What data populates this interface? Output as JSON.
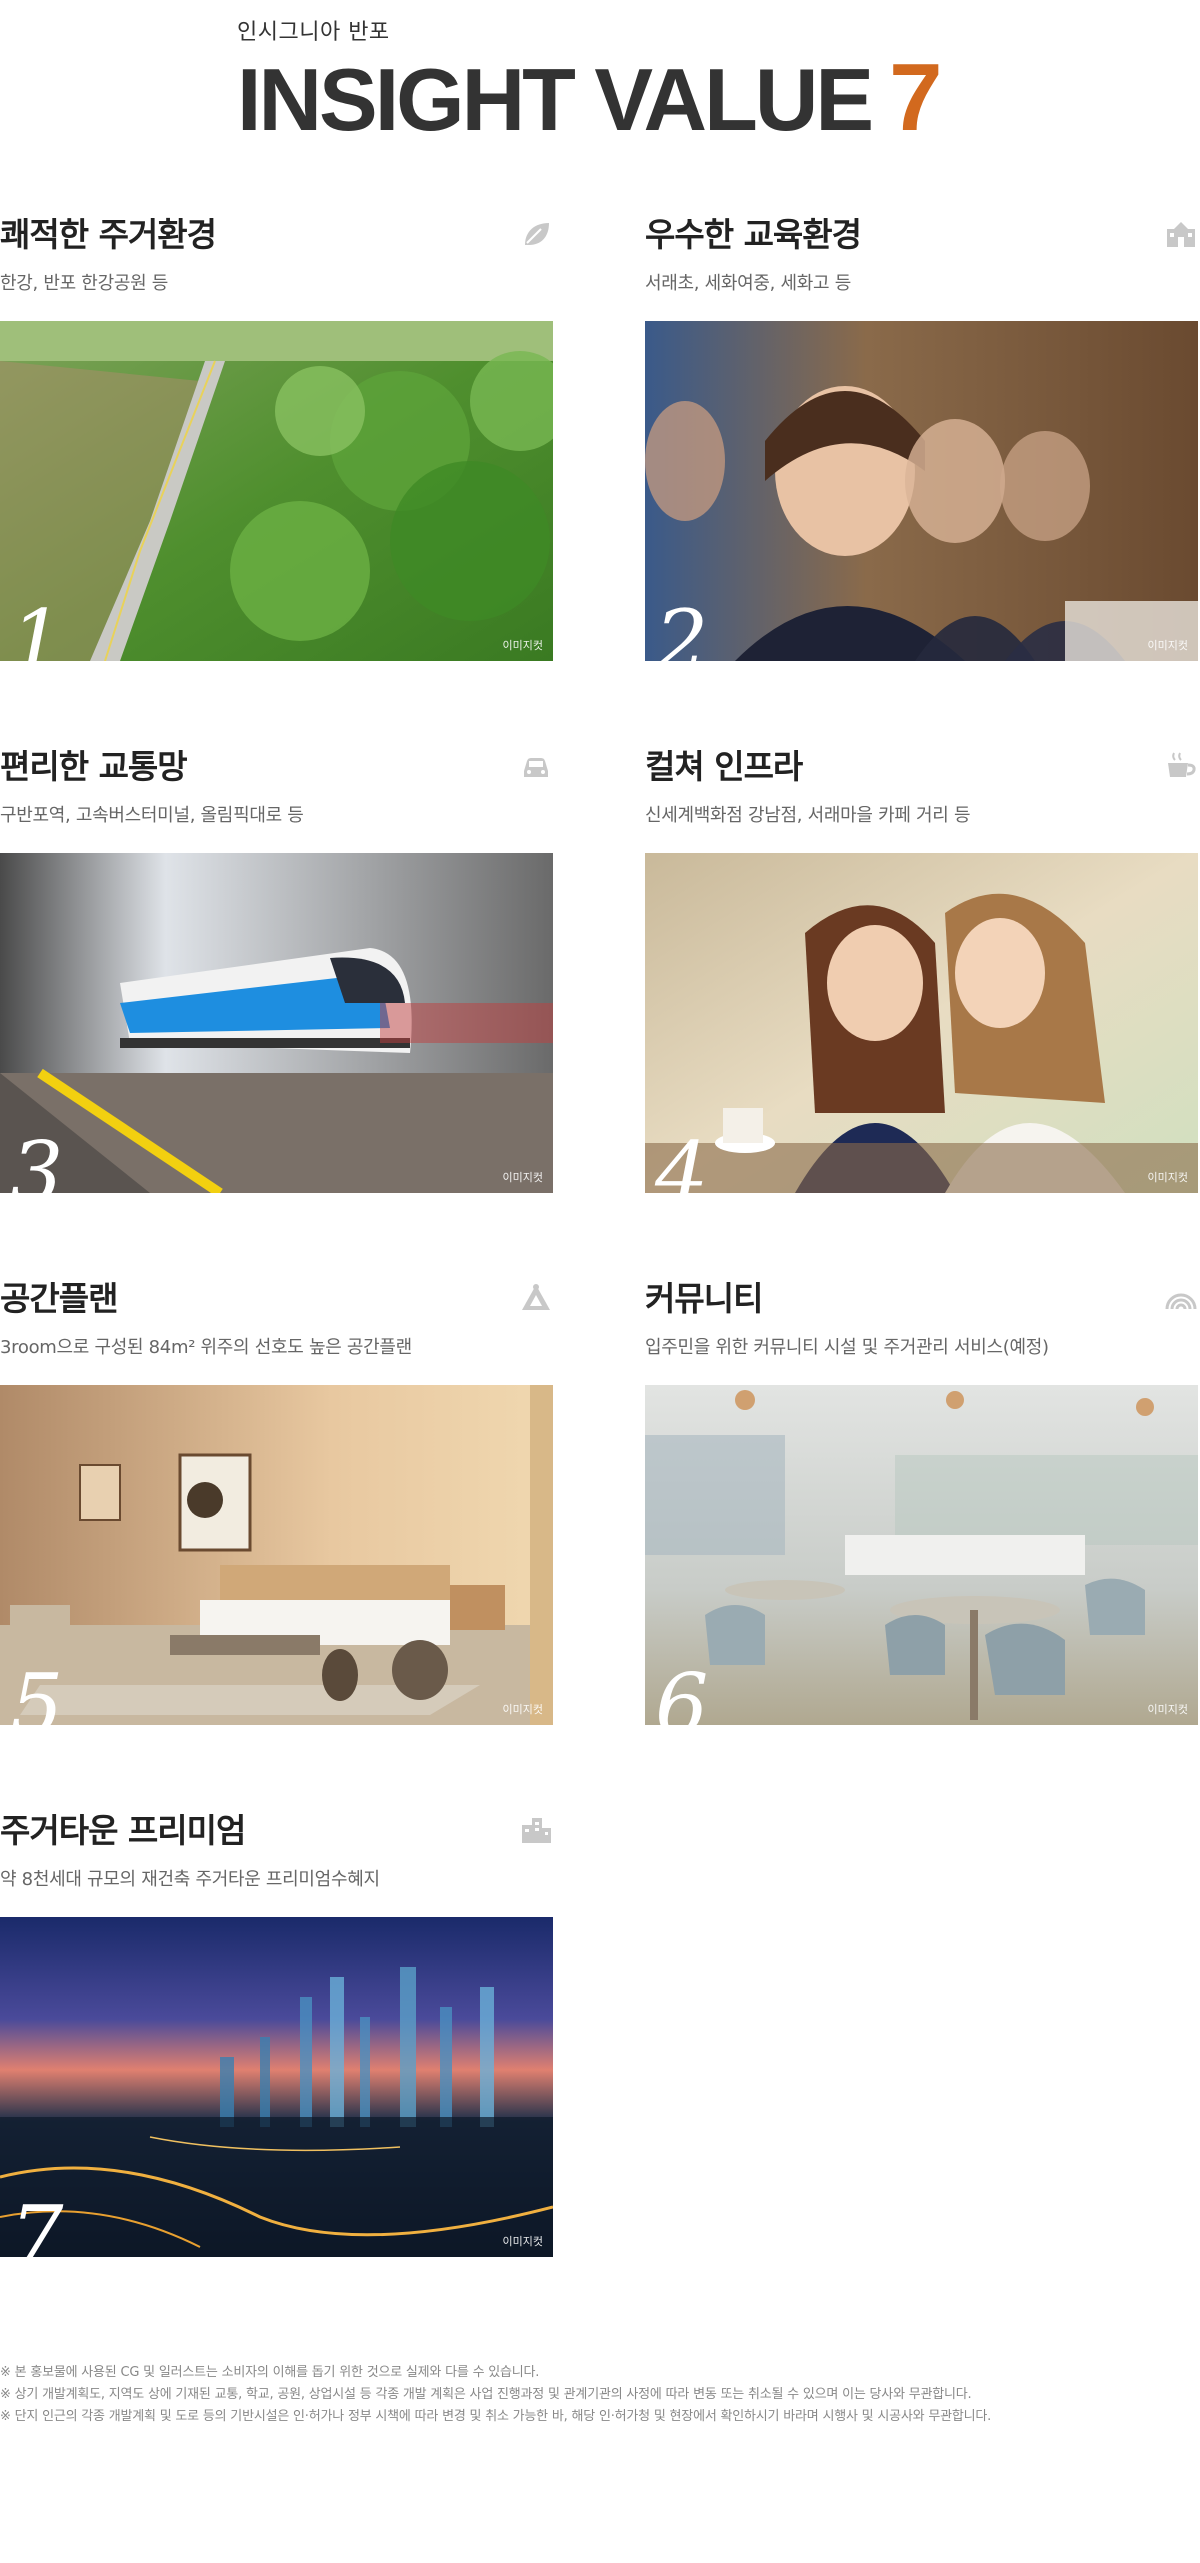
{
  "header": {
    "subtitle": "인시그니아 반포",
    "headline": "INSIGHT VALUE",
    "headline_number": "7",
    "accent_color": "#d2691e"
  },
  "cards": [
    {
      "title": "쾌적한 주거환경",
      "desc": "한강, 반포 한강공원 등",
      "number": "1",
      "tag": "이미지컷",
      "icon": "leaf-icon"
    },
    {
      "title": "우수한 교육환경",
      "desc": "서래초, 세화여중, 세화고 등",
      "number": "2",
      "tag": "이미지컷",
      "icon": "school-icon"
    },
    {
      "title": "편리한 교통망",
      "desc": "구반포역, 고속버스터미널, 올림픽대로 등",
      "number": "3",
      "tag": "이미지컷",
      "icon": "car-icon"
    },
    {
      "title": "컬쳐 인프라",
      "desc": "신세계백화점 강남점, 서래마을 카페 거리 등",
      "number": "4",
      "tag": "이미지컷",
      "icon": "coffee-cup-icon"
    },
    {
      "title": "공간플랜",
      "desc": "3room으로 구성된 84m² 위주의 선호도 높은 공간플랜",
      "number": "5",
      "tag": "이미지컷",
      "icon": "triangle-ruler-icon"
    },
    {
      "title": "커뮤니티",
      "desc": "입주민을 위한 커뮤니티 시설 및 주거관리 서비스(예정)",
      "number": "6",
      "tag": "이미지컷",
      "icon": "rainbow-icon"
    },
    {
      "title": "주거타운 프리미엄",
      "desc": "약 8천세대 규모의 재건축 주거타운 프리미엄수혜지",
      "number": "7",
      "tag": "이미지컷",
      "icon": "buildings-icon"
    }
  ],
  "notes": [
    "※ 본 홍보물에 사용된 CG 및 일러스트는 소비자의 이해를 돕기 위한 것으로 실제와 다를 수 있습니다.",
    "※ 상기 개발계획도, 지역도 상에 기재된 교통, 학교, 공원, 상업시설 등 각종 개발 계획은 사업 진행과정 및 관계기관의 사정에 따라 변동 또는 취소될 수 있으며 이는 당사와 무관합니다.",
    "※ 단지 인근의 각종 개발계획 및 도로 등의 기반시설은 인·허가나 정부 시책에 따라 변경 및 취소 가능한 바, 해당 인·허가청 및 현장에서 확인하시기 바라며 시행사 및 시공사와 무관합니다."
  ]
}
